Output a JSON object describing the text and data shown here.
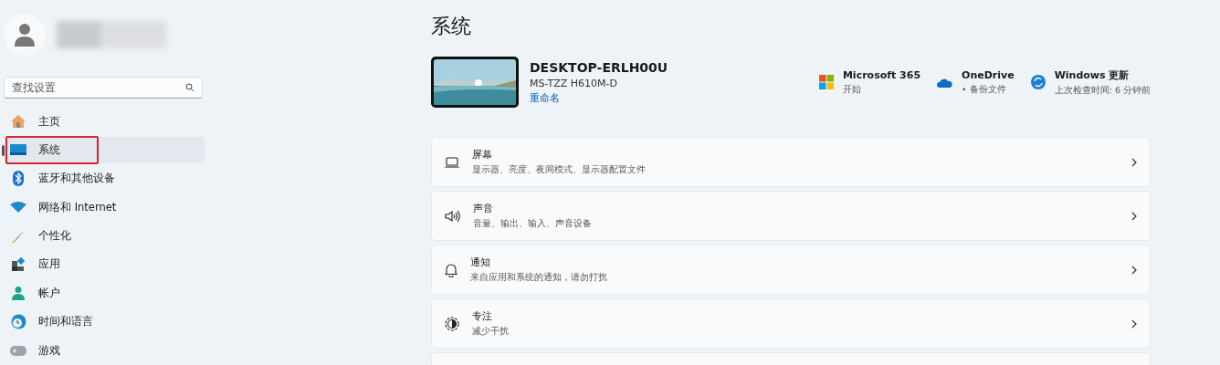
{
  "search": {
    "placeholder": "查找设置"
  },
  "nav": [
    {
      "label": "主页",
      "selected": false,
      "highlighted": false
    },
    {
      "label": "系统",
      "selected": true,
      "highlighted": true
    },
    {
      "label": "蓝牙和其他设备",
      "selected": false,
      "highlighted": false
    },
    {
      "label": "网络和 Internet",
      "selected": false,
      "highlighted": false
    },
    {
      "label": "个性化",
      "selected": false,
      "highlighted": false
    },
    {
      "label": "应用",
      "selected": false,
      "highlighted": false
    },
    {
      "label": "帐户",
      "selected": false,
      "highlighted": false
    },
    {
      "label": "时间和语言",
      "selected": false,
      "highlighted": false
    },
    {
      "label": "游戏",
      "selected": false,
      "highlighted": false
    }
  ],
  "page_title": "系统",
  "device": {
    "name": "DESKTOP-ERLH00U",
    "model": "MS-TZZ H610M-D",
    "rename": "重命名"
  },
  "quick_links": [
    {
      "title": "Microsoft 365",
      "subtitle": "开始"
    },
    {
      "title": "OneDrive",
      "subtitle": "• 备份文件"
    },
    {
      "title": "Windows 更新",
      "subtitle": "上次检查时间: 6 分钟前"
    }
  ],
  "cards": [
    {
      "kind": "setting",
      "title": "屏幕",
      "subtitle": "显示器、亮度、夜间模式、显示器配置文件"
    },
    {
      "kind": "setting",
      "title": "声音",
      "subtitle": "音量、输出、输入、声音设备"
    },
    {
      "kind": "setting",
      "title": "通知",
      "subtitle": "来自应用和系统的通知，请勿打扰"
    },
    {
      "kind": "setting",
      "title": "专注",
      "subtitle": "减少干扰"
    },
    {
      "kind": "cut_off"
    }
  ]
}
